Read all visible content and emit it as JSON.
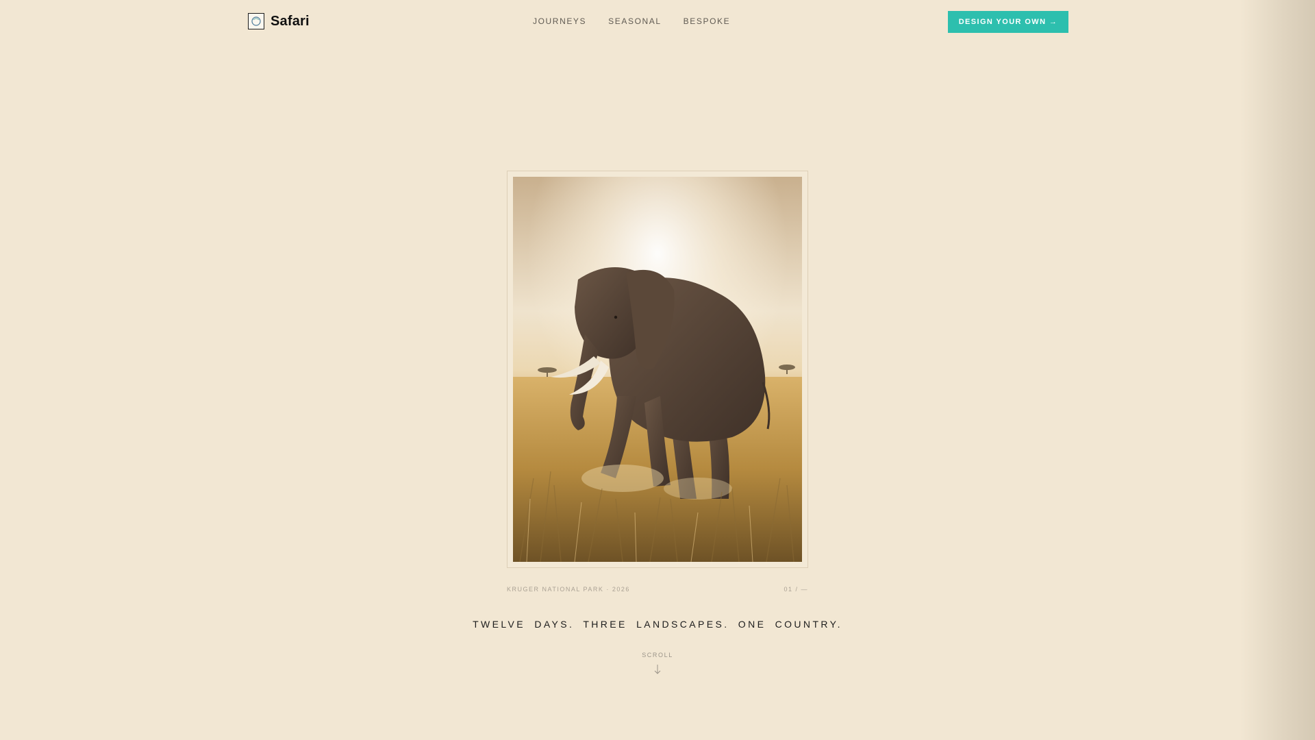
{
  "brand": {
    "name": "Safari",
    "icon": "compass-logo-icon"
  },
  "nav": {
    "links": [
      "JOURNEYS",
      "SEASONAL",
      "BESPOKE"
    ],
    "cta_label": "DESIGN YOUR OWN →",
    "cta_color": "#2dbfae"
  },
  "hero": {
    "image_subject": "Elephant walking through golden savanna grass at sunset",
    "caption_left": "KRUGER NATIONAL PARK · 2026",
    "caption_right": "01 / —",
    "tagline": "TWELVE DAYS.  THREE LANDSCAPES.  ONE COUNTRY.",
    "scroll_label": "SCROLL",
    "scroll_icon": "arrow-down-icon"
  },
  "colors": {
    "background": "#f2e7d3",
    "accent": "#2dbfae",
    "text": "#1c1c1c"
  }
}
